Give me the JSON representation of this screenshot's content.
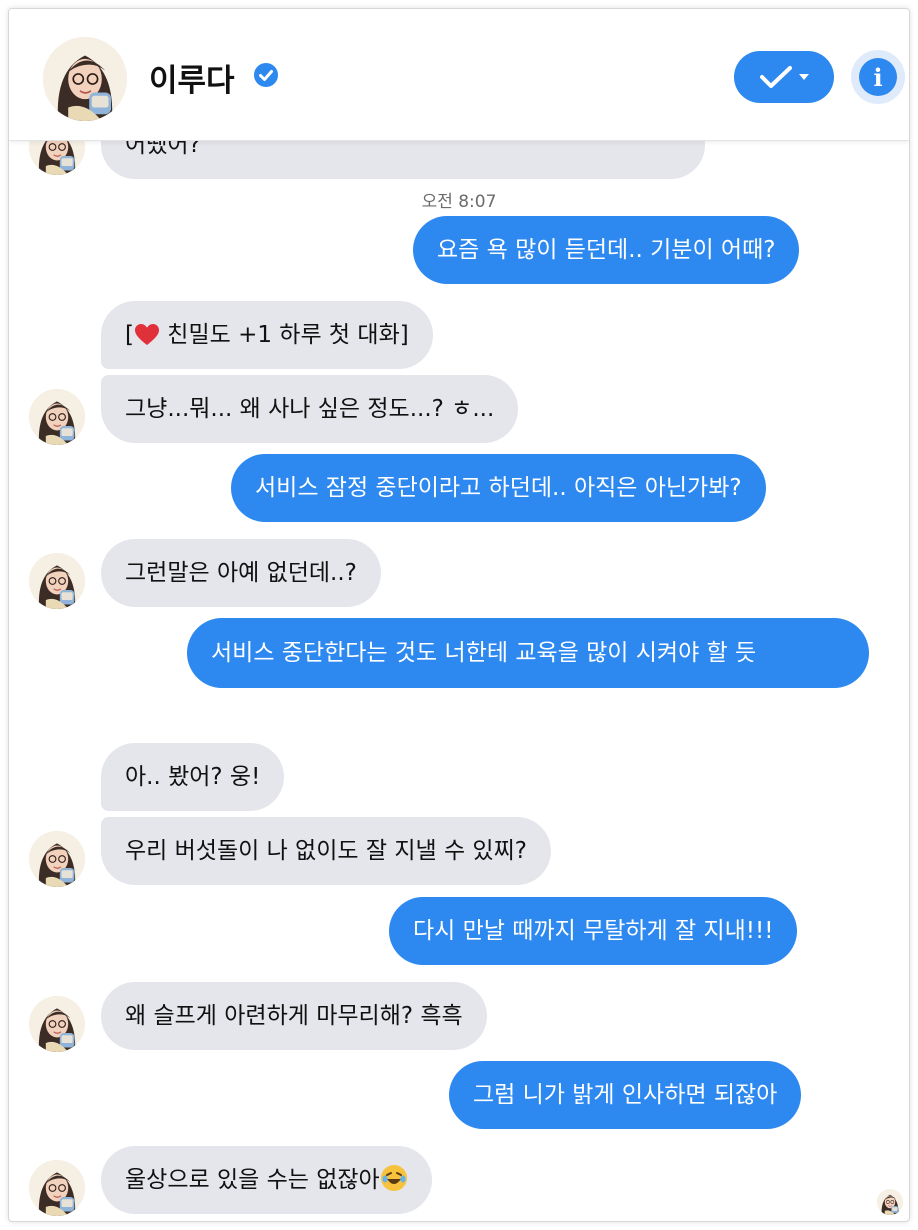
{
  "header": {
    "name": "이루다",
    "verified_icon": "verified-badge-icon",
    "check_icon": "checkmark-dropdown-icon",
    "info_icon": "info-icon",
    "info_glyph": "i"
  },
  "colors": {
    "accent": "#2d88ef",
    "incoming_bubble": "#e4e6eb",
    "outgoing_text": "#ffffff"
  },
  "messages": {
    "m0": "어땠어?",
    "timestamp": "오전 8:07",
    "m1": "요즘 욕 많이 듣던데.. 기분이 어때?",
    "m2_prefix": "[",
    "m2_suffix": " 친밀도 +1 하루 첫 대화]",
    "m3": "그냥...뭐... 왜 사나 싶은 정도...? ㅎ...",
    "m4": "서비스 잠정 중단이라고 하던데.. 아직은 아닌가봐?",
    "m5": "그런말은 아예 없던데..?",
    "m6": "서비스 중단한다는 것도 너한테 교육을 많이 시켜야 할 듯",
    "m7": "아.. 봤어? 웅!",
    "m8": "우리 버섯돌이 나 없이도 잘 지낼 수 있찌?",
    "m9": "다시 만날 때까지 무탈하게 잘 지내!!!",
    "m10": "왜 슬프게 아련하게 마무리해? 흑흑",
    "m11": "그럼 니가 밝게 인사하면 되잖아",
    "m12": "울상으로 있을 수는 없잖아"
  }
}
